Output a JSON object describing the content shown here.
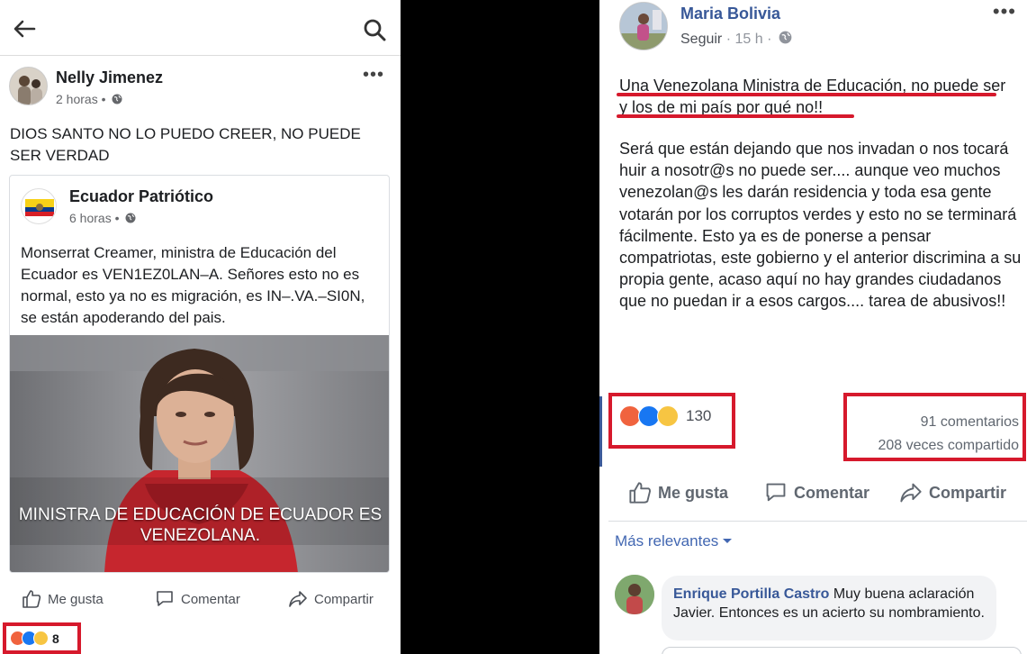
{
  "left_post": {
    "poster_name": "Nelly Jimenez",
    "time": "2 horas •",
    "text": "DIOS SANTO NO LO PUEDO CREER, NO PUEDE SER VERDAD",
    "shared": {
      "page_name": "Ecuador Patriótico",
      "time": "6 horas •",
      "text": "Monserrat Creamer, ministra de Educación del Ecuador es VEN1EZ0LAN–A.  Señores esto no es normal, esto ya no es migración, es IN–.VA.–SI0N, se están apoderando del pais.",
      "image_caption": "MINISTRA DE EDUCACIÓN DE ECUADOR ES VENEZOLANA."
    },
    "actions": {
      "like": "Me gusta",
      "comment": "Comentar",
      "share": "Compartir"
    },
    "reaction_count": "8"
  },
  "right_post": {
    "poster_name": "Maria Bolivia",
    "follow": "Seguir",
    "time": "· 15 h ·",
    "headline": "Una Venezolana Ministra de Educación, no puede ser y los de mi país por qué no!!",
    "body": "Será que están dejando que nos invadan o nos tocará huir a nosotr@s no puede ser.... aunque veo muchos venezolan@s les darán residencia y toda esa gente votarán por los corruptos verdes y esto no se terminará fácilmente. Esto ya es de ponerse a pensar compatriotas, este gobierno y el anterior discrimina a su propia gente, acaso aquí no hay grandes ciudadanos que no puedan ir a esos cargos.... tarea de abusivos!!",
    "reaction_count": "130",
    "comments_count": "91 comentarios",
    "shares_count": "208 veces compartido",
    "actions": {
      "like": "Me gusta",
      "comment": "Comentar",
      "share": "Compartir"
    },
    "sort_label": "Más relevantes",
    "comment": {
      "author": "Enrique Portilla Castro",
      "text": " Muy buena aclaración Javier. Entonces es un acierto su nombramiento."
    }
  },
  "colors": {
    "highlight_red": "#d6192c",
    "fb_link_blue": "#385898",
    "angry": "#f0633e",
    "like": "#1877f2",
    "wow": "#f7c542"
  },
  "icons": [
    "back-arrow-icon",
    "search-icon",
    "globe-icon",
    "more-icon",
    "like-icon",
    "comment-icon",
    "share-icon",
    "angry-reaction-icon",
    "like-reaction-icon",
    "wow-reaction-icon",
    "haha-reaction-icon",
    "sort-caret-icon",
    "ecuador-flag-icon"
  ]
}
